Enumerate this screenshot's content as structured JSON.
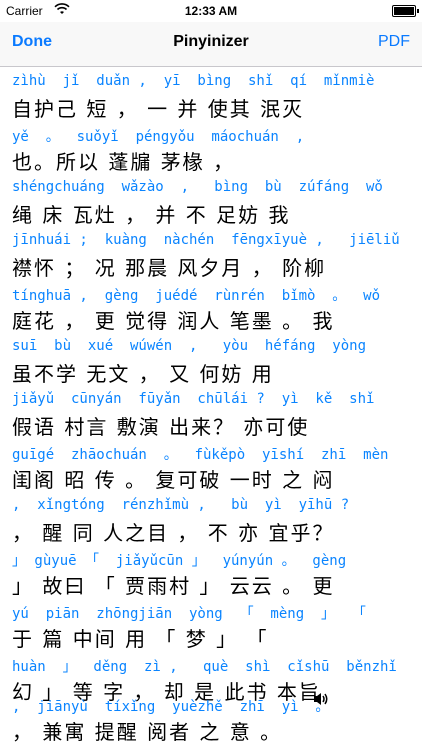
{
  "status": {
    "carrier": "Carrier",
    "time": "12:33 AM"
  },
  "nav": {
    "done": "Done",
    "title": "Pinyinizer",
    "pdf": "PDF"
  },
  "lines": [
    {
      "pinyin": "zìhù  jǐ  duǎn ,  yī  bìng  shǐ  qí  mǐnmiè",
      "hanzi": "自护己 短 ， 一 并 使其 泯灭"
    },
    {
      "pinyin": "yě  。  suǒyǐ  péngyǒu  máochuán  ,",
      "hanzi": "也。所以 蓬牖 茅椽 ，"
    },
    {
      "pinyin": "shéngchuáng  wǎzào  ,   bìng  bù  zúfáng  wǒ",
      "hanzi": "绳 床 瓦灶 ， 并 不 足妨 我"
    },
    {
      "pinyin": "jīnhuái ;  kuàng  nàchén  fēngxīyuè ,   jiēliǔ",
      "hanzi": "襟怀 ； 况 那晨 风夕月 ， 阶柳"
    },
    {
      "pinyin": "tínghuā ,  gèng  juédé  rùnrén  bǐmò  。  wǒ",
      "hanzi": "庭花 ， 更 觉得 润人 笔墨 。 我"
    },
    {
      "pinyin": "suī  bù  xué  wúwén  ,   yòu  héfáng  yòng",
      "hanzi": "虽不学 无文 ， 又 何妨 用"
    },
    {
      "pinyin": "jiǎyǔ  cūnyán  fūyǎn  chūlái ?  yì  kě  shǐ",
      "hanzi": "假语 村言 敷演 出来？ 亦可使"
    },
    {
      "pinyin": "guīgé  zhāochuán  。  fùkěpò  yīshí  zhī  mèn",
      "hanzi": "闺阁 昭 传 。 复可破 一时 之 闷"
    },
    {
      "pinyin": ",  xǐngtóng  rénzhǐmù ,   bù  yì  yīhū ?",
      "hanzi": "， 醒 同 人之目 ， 不 亦 宜乎？"
    },
    {
      "pinyin": "」 gùyuē 「  jiǎyǔcūn 」  yúnyún 。  gèng",
      "hanzi": "」 故曰 「 贾雨村 」 云云 。 更"
    },
    {
      "pinyin": "yú  piān  zhōngjiān  yòng  「  mèng  」  「",
      "hanzi": "于 篇 中间 用 「 梦 」 「"
    },
    {
      "pinyin": "huàn  」  děng  zì ,   què  shì  cǐshū  běnzhǐ",
      "hanzi": "幻 」 等 字 ， 却 是 此书 本旨"
    },
    {
      "pinyin": ",  jiānyù  tíxǐng  yuèzhě  zhī  yì  。",
      "hanzi": "， 兼寓 提醒 阅者 之 意 。"
    }
  ]
}
